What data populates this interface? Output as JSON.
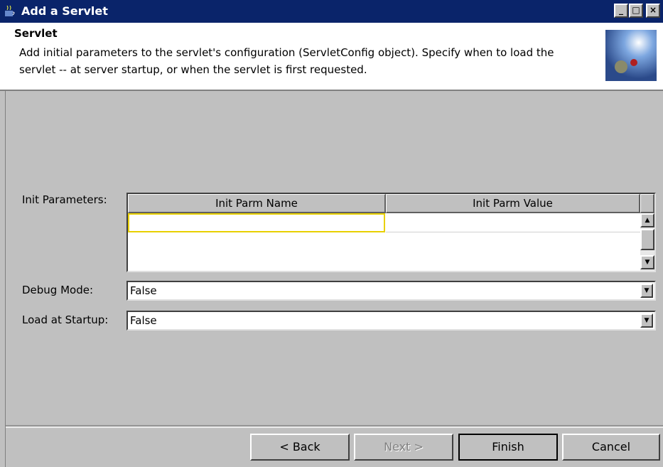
{
  "window": {
    "title": "Add a Servlet",
    "icon": "coffee-cup-icon"
  },
  "header": {
    "title": "Servlet",
    "description": "Add initial parameters to the servlet's configuration (ServletConfig object). Specify when to load the servlet -- at server startup, or when the servlet is first requested."
  },
  "init_params": {
    "label": "Init Parameters:",
    "columns": [
      "Init Parm Name",
      "Init Parm Value"
    ],
    "rows": [
      [
        "",
        ""
      ]
    ]
  },
  "debug_mode": {
    "label": "Debug Mode:",
    "value": "False"
  },
  "load_startup": {
    "label": "Load at Startup:",
    "value": "False"
  },
  "buttons": {
    "back": "< Back",
    "next": "Next >",
    "finish": "Finish",
    "cancel": "Cancel"
  },
  "colors": {
    "titlebar": "#0a246a",
    "dialog": "#c0c0c0",
    "focus": "#e8d000"
  }
}
